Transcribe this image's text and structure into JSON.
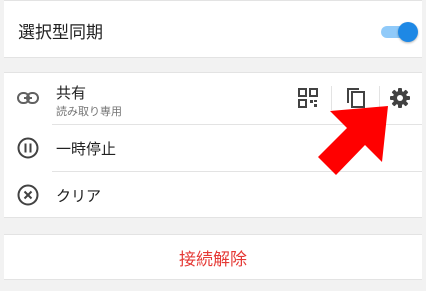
{
  "settings": {
    "selective_sync": {
      "label": "選択型同期",
      "enabled": true
    }
  },
  "share": {
    "title": "共有",
    "subtitle": "読み取り専用",
    "icons": {
      "link": "link-icon",
      "qr": "qr-code-icon",
      "copy": "copy-icon",
      "settings": "gear-icon"
    }
  },
  "menu": {
    "pause": {
      "label": "一時停止",
      "icon": "pause-icon"
    },
    "clear": {
      "label": "クリア",
      "icon": "close-circle-icon"
    }
  },
  "disconnect": {
    "label": "接続解除"
  },
  "colors": {
    "accent": "#1e88e5",
    "danger": "#e53935",
    "annotation_arrow": "#ff0000"
  }
}
